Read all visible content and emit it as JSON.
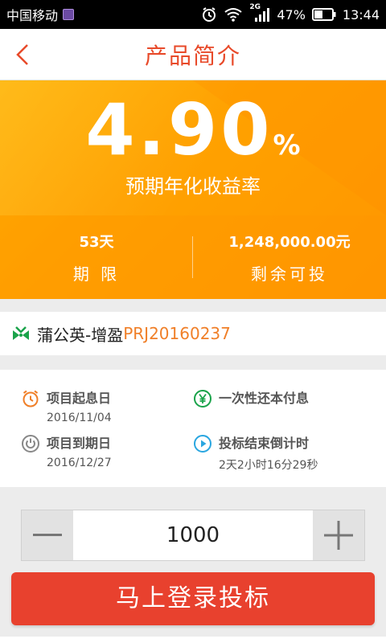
{
  "status_bar": {
    "carrier": "中国移动",
    "network": "2G",
    "battery": "47%",
    "time": "13:44"
  },
  "nav": {
    "title": "产品简介"
  },
  "hero": {
    "rate_value": "4.90",
    "rate_unit": "%",
    "rate_label": "预期年化收益率",
    "term_value": "53天",
    "term_label": "期 限",
    "remaining_value": "1,248,000.00元",
    "remaining_label": "剩余可投"
  },
  "product": {
    "name": "蒲公英-增盈",
    "code": "PRJ20160237"
  },
  "info": {
    "start_label": "项目起息日",
    "start_value": "2016/11/04",
    "repay_label": "一次性还本付息",
    "end_label": "项目到期日",
    "end_value": "2016/12/27",
    "countdown_label": "投标结束倒计时",
    "countdown_value": "2天2小时16分29秒"
  },
  "stepper": {
    "value": "1000"
  },
  "cta": {
    "label": "马上登录投标"
  },
  "colors": {
    "accent": "#e84a2a",
    "hero_orange": "#ffa200",
    "code_orange": "#f07f28",
    "button_red": "#e8412e"
  }
}
